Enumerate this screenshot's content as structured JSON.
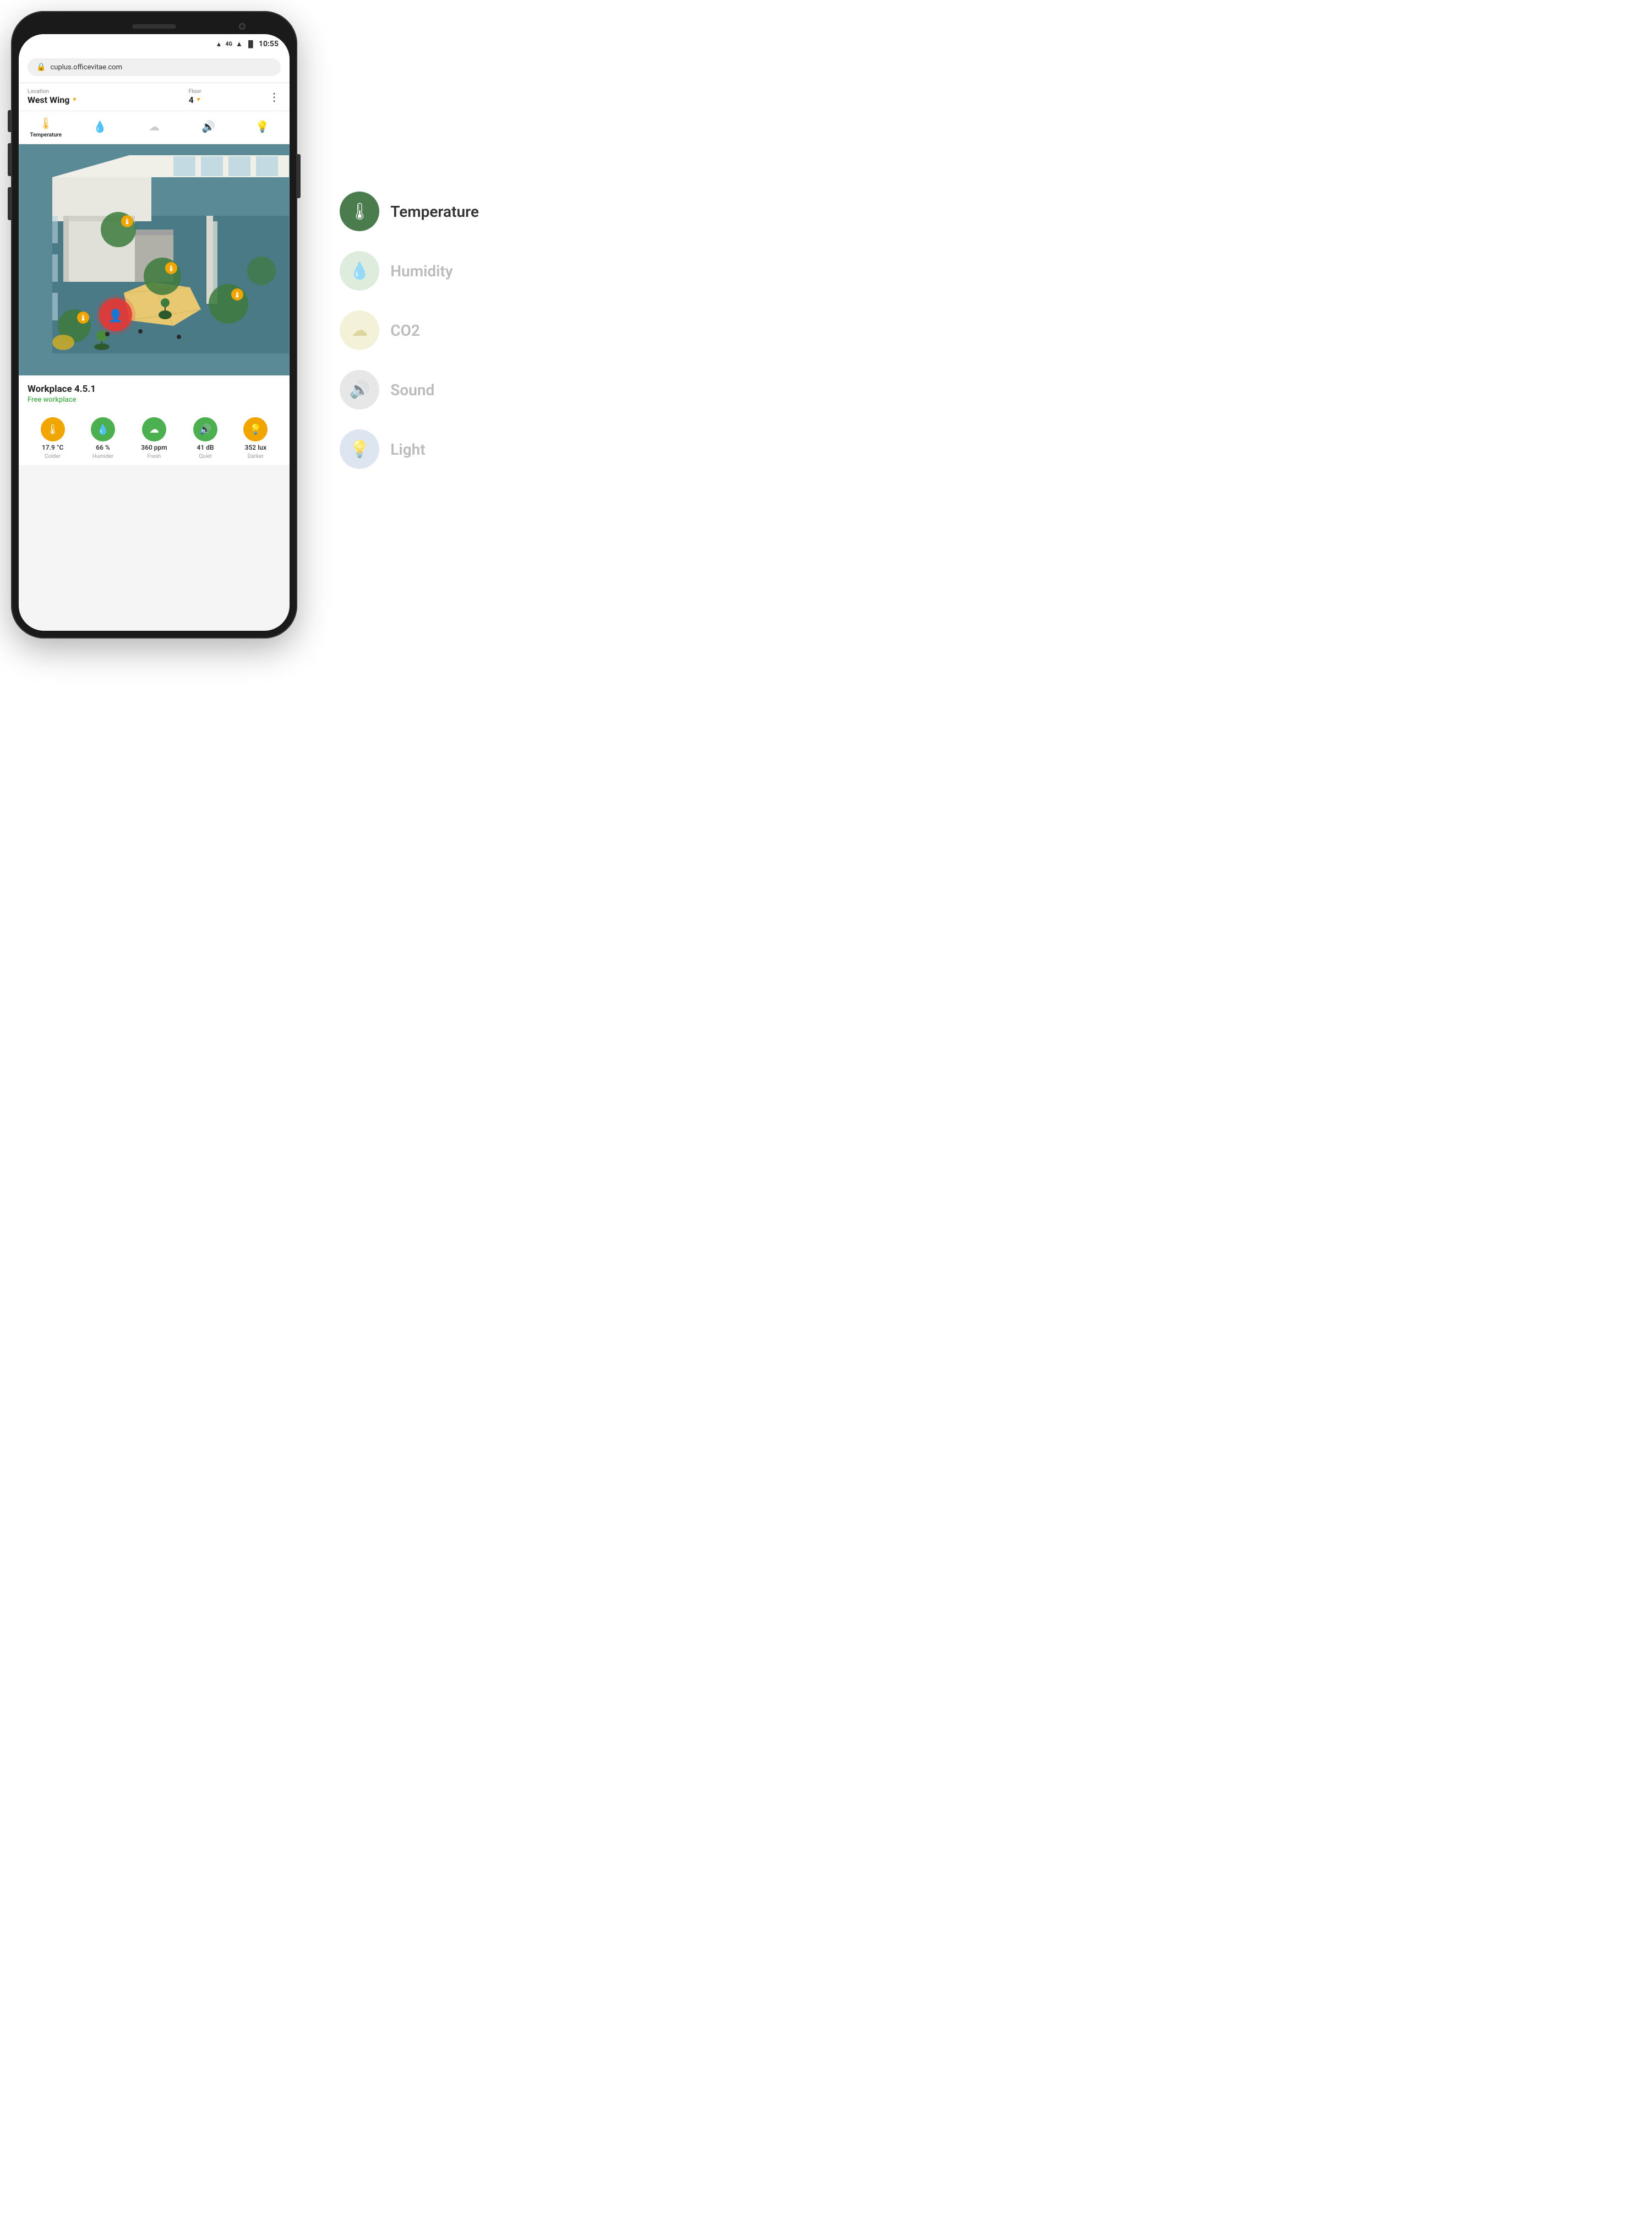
{
  "phone": {
    "statusBar": {
      "time": "10:55",
      "signal": "4G",
      "wifiIcon": "▲",
      "batteryIcon": "▮"
    },
    "urlBar": {
      "lockIcon": "🔒",
      "url": "cuplus.officevitae.com"
    },
    "locationBar": {
      "locationLabel": "Location",
      "locationValue": "West Wing",
      "floorLabel": "Floor",
      "floorValue": "4",
      "moreBtn": "⋮"
    },
    "sensorTabs": [
      {
        "id": "temperature",
        "label": "Temperature",
        "icon": "🌡",
        "active": true
      },
      {
        "id": "humidity",
        "label": "",
        "icon": "💧",
        "active": false
      },
      {
        "id": "co2",
        "label": "",
        "icon": "☁",
        "active": false
      },
      {
        "id": "sound",
        "label": "",
        "icon": "🔊",
        "active": false
      },
      {
        "id": "light",
        "label": "",
        "icon": "💡",
        "active": false
      }
    ],
    "workplacePanel": {
      "name": "Workplace 4.5.1",
      "status": "Free workplace",
      "readings": [
        {
          "icon": "🌡",
          "iconBg": "#f0a500",
          "value": "17.9 °C",
          "desc": "Colder"
        },
        {
          "icon": "💧",
          "iconBg": "#4caf50",
          "value": "66 %",
          "desc": "Humider"
        },
        {
          "icon": "☁",
          "iconBg": "#4caf50",
          "value": "360 ppm",
          "desc": "Fresh"
        },
        {
          "icon": "🔊",
          "iconBg": "#4caf50",
          "value": "41 dB",
          "desc": "Quiet"
        },
        {
          "icon": "💡",
          "iconBg": "#f0a500",
          "value": "352 lux",
          "desc": "Darker"
        }
      ]
    }
  },
  "legend": {
    "items": [
      {
        "id": "temperature",
        "label": "Temperature",
        "icon": "🌡",
        "bg": "#4a7c4e",
        "active": true
      },
      {
        "id": "humidity",
        "label": "Humidity",
        "icon": "💧",
        "bg": "#b8d4b8",
        "active": false
      },
      {
        "id": "co2",
        "label": "CO2",
        "icon": "☁",
        "bg": "#e8d8a0",
        "active": false
      },
      {
        "id": "sound",
        "label": "Sound",
        "icon": "🔊",
        "bg": "#cccccc",
        "active": false
      },
      {
        "id": "light",
        "label": "Light",
        "icon": "💡",
        "bg": "#c8d4e8",
        "active": false
      }
    ]
  }
}
